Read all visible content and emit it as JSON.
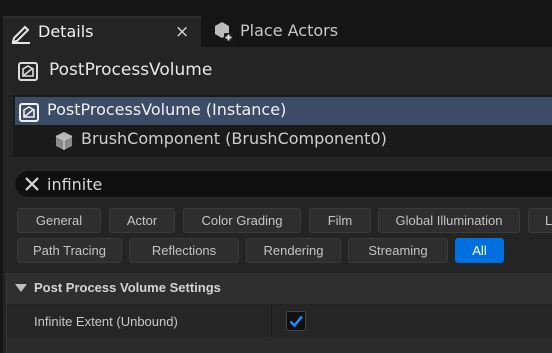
{
  "tabs": {
    "details_label": "Details",
    "details_close": "×",
    "place_actors_label": "Place Actors"
  },
  "actor": {
    "name": "PostProcessVolume"
  },
  "components": [
    {
      "label": "PostProcessVolume (Instance)",
      "selected": true,
      "icon": "actor-cube-icon"
    },
    {
      "label": "BrushComponent (BrushComponent0)",
      "selected": false,
      "icon": "brush-component-icon"
    }
  ],
  "search": {
    "value": "infinite"
  },
  "categories": {
    "row1": [
      "General",
      "Actor",
      "Color Grading",
      "Film",
      "Global Illumination",
      "L"
    ],
    "row2": [
      "Path Tracing",
      "Reflections",
      "Rendering",
      "Streaming",
      "All"
    ],
    "active": "All"
  },
  "section": {
    "title": "Post Process Volume Settings",
    "expanded": true
  },
  "properties": [
    {
      "label": "Infinite Extent (Unbound)",
      "checked": true
    }
  ],
  "colors": {
    "accent": "#0070e0",
    "selected_row": "#3c4c66",
    "panel_bg": "#242424"
  }
}
